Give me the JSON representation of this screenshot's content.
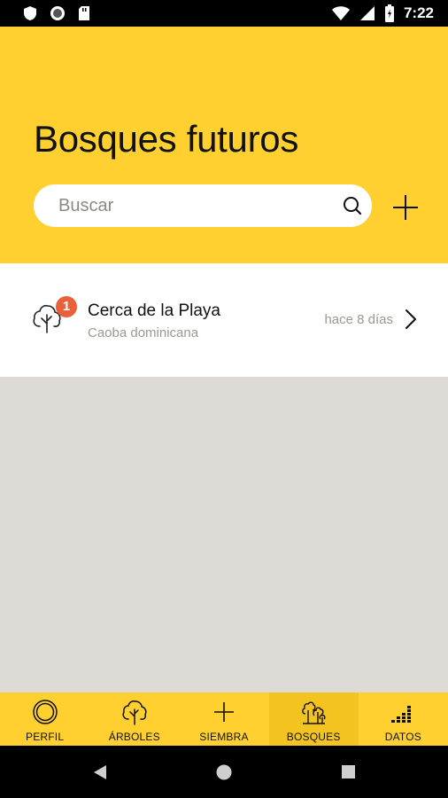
{
  "status_bar": {
    "time": "7:22",
    "icons": [
      "shield-icon",
      "circle-icon",
      "sd-card-icon",
      "wifi-icon",
      "signal-icon",
      "battery-icon"
    ]
  },
  "header": {
    "title": "Bosques futuros",
    "search": {
      "placeholder": "Buscar",
      "value": ""
    },
    "add_icon": "plus-icon"
  },
  "list": {
    "items": [
      {
        "title": "Cerca de la Playa",
        "subtitle": "Caoba dominicana",
        "time": "hace 8 días",
        "badge": "1",
        "icon": "tree-icon"
      }
    ]
  },
  "bottom_nav": {
    "items": [
      {
        "label": "PERFIL",
        "icon": "profile-rings-icon",
        "active": false
      },
      {
        "label": "ÁRBOLES",
        "icon": "tree-icon",
        "active": false
      },
      {
        "label": "SIEMBRA",
        "icon": "plus-icon",
        "active": false
      },
      {
        "label": "BOSQUES",
        "icon": "forest-icon",
        "active": true
      },
      {
        "label": "DATOS",
        "icon": "bar-chart-icon",
        "active": false
      }
    ]
  },
  "colors": {
    "accent": "#ffd02f",
    "active_tab": "#f3c420",
    "badge": "#e9603a",
    "background": "#dedad5"
  },
  "android_nav": {
    "icons": [
      "back-icon",
      "home-icon",
      "recents-icon"
    ]
  }
}
